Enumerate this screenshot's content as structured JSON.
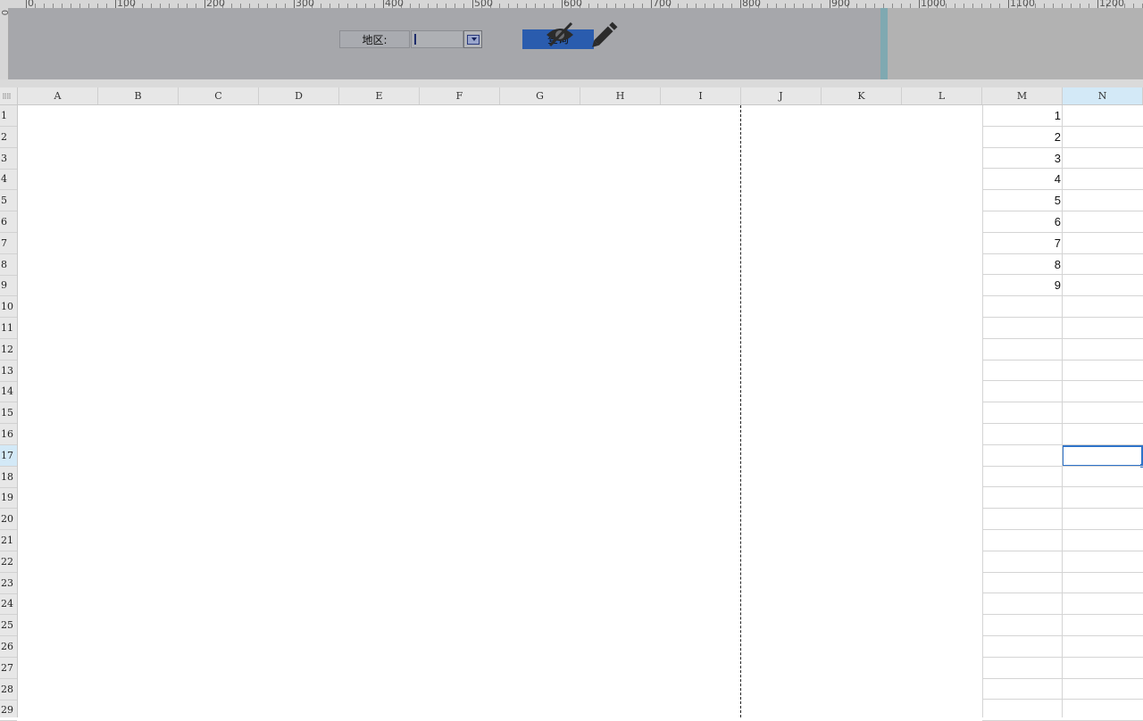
{
  "ruler": {
    "labels": [
      "0",
      "100",
      "200",
      "300",
      "400",
      "500",
      "600",
      "700",
      "800",
      "900",
      "1000",
      "1100",
      "1200"
    ],
    "left_label": "0"
  },
  "parameter_panel": {
    "region_label": "地区:",
    "region_value": "",
    "query_button_label": "查询",
    "icons": [
      "hide-eye-icon",
      "pencil-edit-icon",
      "dropdown-arrow-icon"
    ]
  },
  "sheet": {
    "columns": [
      "A",
      "B",
      "C",
      "D",
      "E",
      "F",
      "G",
      "H",
      "I",
      "J",
      "K",
      "L",
      "M",
      "N"
    ],
    "selected_column": "N",
    "rows": [
      "1",
      "2",
      "3",
      "4",
      "5",
      "6",
      "7",
      "8",
      "9",
      "10",
      "11",
      "12",
      "13",
      "14",
      "15",
      "16",
      "17",
      "18",
      "19",
      "20",
      "21",
      "22",
      "23",
      "24",
      "25",
      "26",
      "27",
      "28",
      "29"
    ],
    "selected_row": "17",
    "column_m_values": [
      "1",
      "2",
      "3",
      "4",
      "5",
      "6",
      "7",
      "8",
      "9"
    ]
  },
  "colors": {
    "query_button": "#2a5cae",
    "selection_border": "#2f73c9",
    "header_selected": "#d3e9f7",
    "panel_bg": "#a6a7ab"
  }
}
